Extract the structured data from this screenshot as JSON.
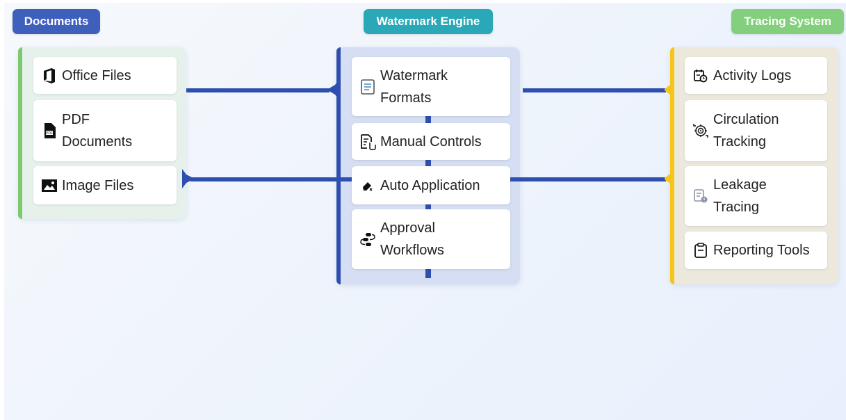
{
  "groups": {
    "documents": {
      "label": "Documents",
      "color": "#3f5fbd",
      "lane_bg": "#e6f1ec",
      "stripe": "#7cc96f",
      "items": [
        {
          "label": "Office Files",
          "icon": "office-icon"
        },
        {
          "label": "PDF Documents",
          "icon": "pdf-icon"
        },
        {
          "label": "Image Files",
          "icon": "image-icon"
        }
      ]
    },
    "engine": {
      "label": "Watermark Engine",
      "color": "#2ba8b8",
      "lane_bg": "#d5def2",
      "stripe": "#2e4fb0",
      "items": [
        {
          "label": "Watermark Formats",
          "icon": "formats-icon"
        },
        {
          "label": "Manual Controls",
          "icon": "manual-controls-icon"
        },
        {
          "label": "Auto Application",
          "icon": "auto-apply-icon"
        },
        {
          "label": "Approval Workflows",
          "icon": "workflow-icon"
        }
      ]
    },
    "tracing": {
      "label": "Tracing System",
      "color": "#84cf7d",
      "lane_bg": "#ece9dc",
      "stripe": "#f5c518",
      "items": [
        {
          "label": "Activity Logs",
          "icon": "activity-log-icon"
        },
        {
          "label": "Circulation Tracking",
          "icon": "circulation-icon"
        },
        {
          "label": "Leakage Tracing",
          "icon": "leakage-icon"
        },
        {
          "label": "Reporting Tools",
          "icon": "reporting-icon"
        }
      ]
    }
  },
  "connector_color": "#2e4fb0"
}
